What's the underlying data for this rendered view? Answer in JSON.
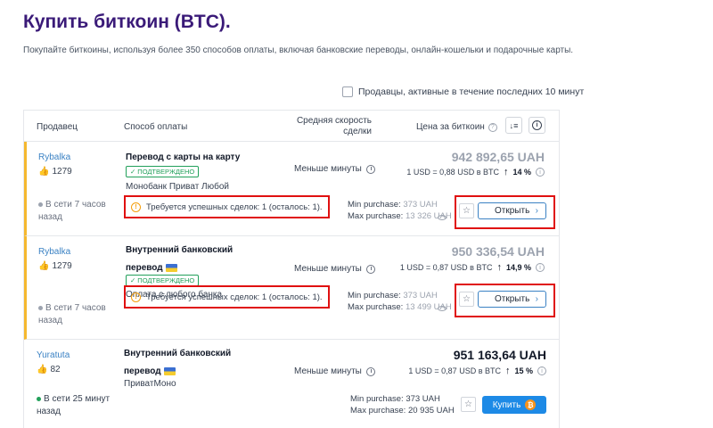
{
  "page": {
    "title": "Купить биткоин (BTC).",
    "subtitle": "Покупайте биткоины, используя более 350 способов оплаты, включая банковские переводы, онлайн-кошельки и подарочные карты."
  },
  "filter": {
    "label": "Продавцы, активные в течение последних 10 минут",
    "checked": false
  },
  "table": {
    "headers": {
      "seller": "Продавец",
      "payment": "Способ оплаты",
      "speed": "Средняя скорость сделки",
      "price": "Цена за биткоин"
    },
    "sort_icon": "sort-icon",
    "info_icon": "info-icon"
  },
  "offers": [
    {
      "seller": "Rybalka",
      "rating": "1279",
      "online": "В сети 7 часов назад",
      "payment_title": "Перевод с карты на карту",
      "verified": "ПОДТВЕРЖДЕНО",
      "payment_sub": "Монобанк Приват Любой",
      "speed": "Меньше минуты",
      "price": "942 892,65 UAH",
      "rate": "1 USD = 0,88 USD в BTC",
      "percent": "14 %",
      "warning": "Требуется успешных сделок: 1 (осталось: 1).",
      "min_label": "Min purchase:",
      "min_value": "373 UAH",
      "max_label": "Max purchase:",
      "max_value": "13 326 UAH",
      "action": "Открыть"
    },
    {
      "seller": "Rybalka",
      "rating": "1279",
      "online": "В сети 7 часов назад",
      "payment_title_1": "Внутренний банковский",
      "payment_title_2": "перевод",
      "verified": "ПОДТВЕРЖДЕНО",
      "payment_sub": "Оплата с любого банка",
      "speed": "Меньше минуты",
      "price": "950 336,54 UAH",
      "rate": "1 USD = 0,87 USD в BTC",
      "percent": "14,9 %",
      "warning": "Требуется успешных сделок: 1 (осталось: 1).",
      "min_label": "Min purchase:",
      "min_value": "373 UAH",
      "max_label": "Max purchase:",
      "max_value": "13 499 UAH",
      "action": "Открыть"
    },
    {
      "seller": "Yuratuta",
      "rating": "82",
      "online": "В сети 25 минут назад",
      "payment_title_1": "Внутренний банковский",
      "payment_title_2": "перевод",
      "payment_sub": "ПриватМоно",
      "speed": "Меньше минуты",
      "price": "951 163,64 UAH",
      "rate": "1 USD = 0,87 USD в BTC",
      "percent": "15 %",
      "min_label": "Min purchase:",
      "min_value": "373 UAH",
      "max_label": "Max purchase:",
      "max_value": "20 935 UAH",
      "action": "Купить"
    }
  ],
  "colors": {
    "title": "#3a1a78",
    "link": "#3b82c4",
    "highlight_border": "#f5b82e",
    "annotation_red": "#e01010",
    "buy_button": "#1d8ae6",
    "verified_green": "#22a05a"
  }
}
